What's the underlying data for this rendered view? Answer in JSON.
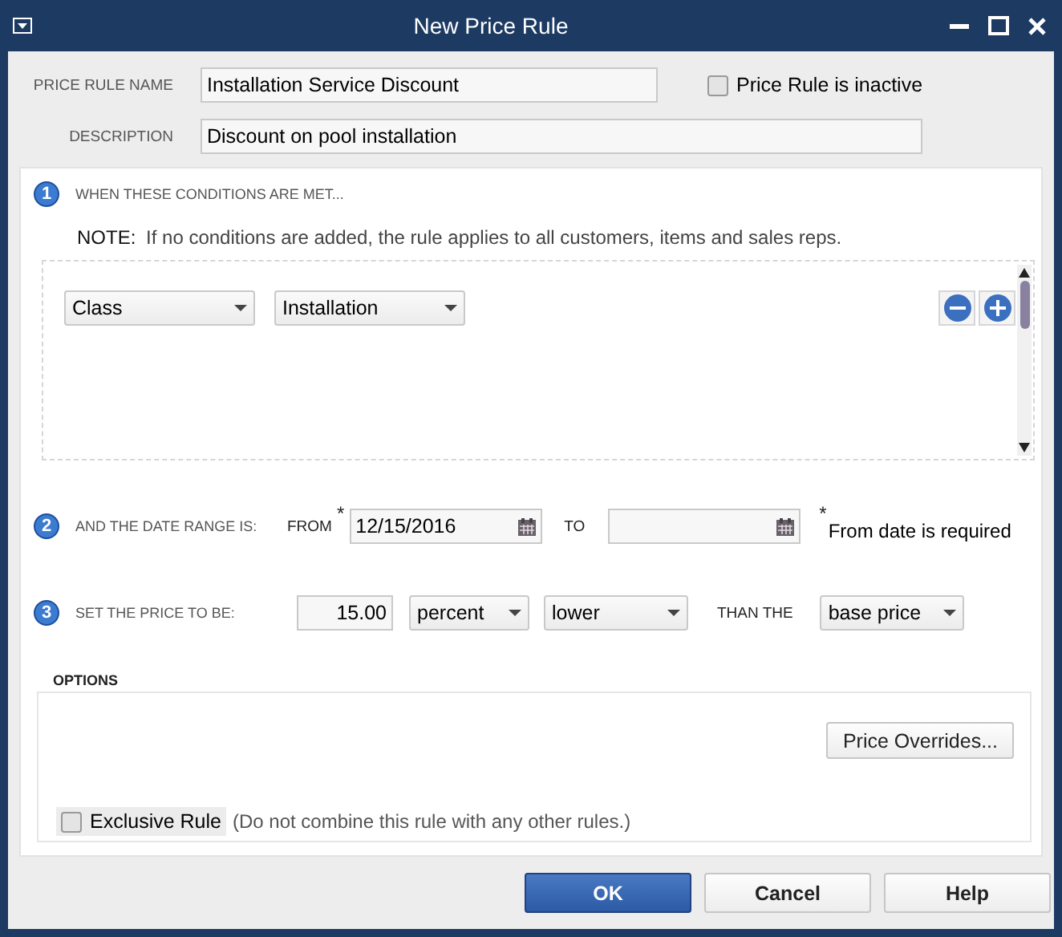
{
  "window": {
    "title": "New Price Rule"
  },
  "name_field": {
    "label": "PRICE RULE NAME",
    "value": "Installation Service Discount"
  },
  "inactive": {
    "label": "Price Rule is inactive",
    "checked": false
  },
  "description_field": {
    "label": "DESCRIPTION",
    "value": "Discount on pool installation"
  },
  "step1": {
    "number": "1",
    "heading": "WHEN THESE CONDITIONS ARE MET...",
    "note_label": "NOTE:",
    "note": "If no conditions are added, the rule applies to all customers, items and sales reps.",
    "conditions": [
      {
        "type": "Class",
        "value": "Installation"
      }
    ]
  },
  "step2": {
    "number": "2",
    "heading": "AND THE DATE RANGE IS:",
    "from_label": "FROM",
    "required_mark": "*",
    "from_value": "12/15/2016",
    "to_label": "TO",
    "footnote_mark": "*",
    "footnote": "From date is required"
  },
  "step3": {
    "number": "3",
    "heading": "SET THE PRICE TO BE:",
    "amount": "15.00",
    "unit": "percent",
    "direction": "lower",
    "than_label": "THAN THE",
    "basis": "base price"
  },
  "options": {
    "heading": "OPTIONS",
    "overrides_button": "Price Overrides...",
    "exclusive": {
      "label": "Exclusive Rule",
      "checked": false,
      "hint": "(Do not combine this rule with any other rules.)"
    }
  },
  "buttons": [
    "OK",
    "Cancel",
    "Help"
  ]
}
